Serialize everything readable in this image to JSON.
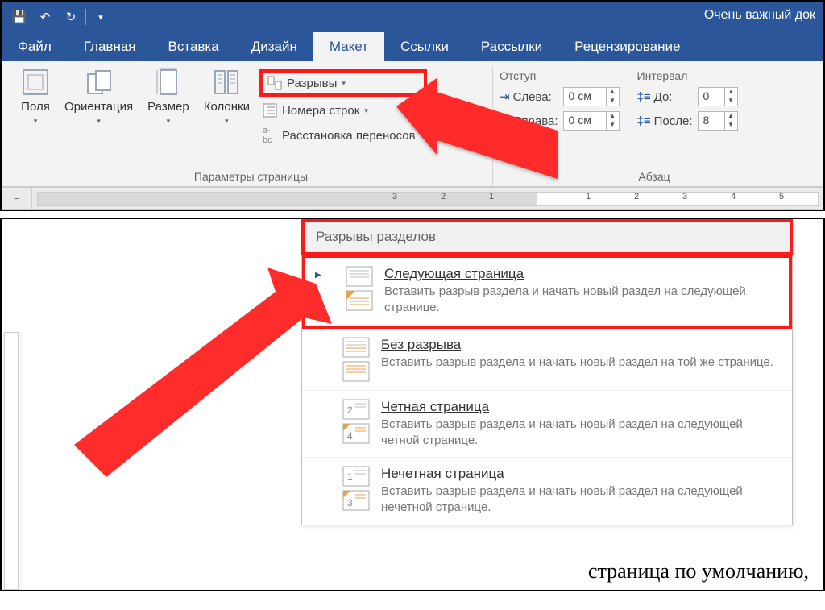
{
  "title": "Очень важный док",
  "tabs": [
    "Файл",
    "Главная",
    "Вставка",
    "Дизайн",
    "Макет",
    "Ссылки",
    "Рассылки",
    "Рецензирование"
  ],
  "active_tab_index": 4,
  "page_setup": {
    "margins": "Поля",
    "orientation": "Ориентация",
    "size": "Размер",
    "columns": "Колонки",
    "breaks": "Разрывы",
    "line_numbers": "Номера строк",
    "hyphenation": "Расстановка переносов",
    "group_label": "Параметры страницы"
  },
  "paragraph": {
    "indent_header": "Отступ",
    "spacing_header": "Интервал",
    "left_label": "Слева:",
    "right_label": "Справа:",
    "before_label": "До:",
    "after_label": "После:",
    "left_value": "0 см",
    "right_value": "0 см",
    "before_value": "0",
    "after_value": "8",
    "group_label": "Абзац"
  },
  "ruler_numbers": [
    "3",
    "2",
    "1",
    "1",
    "2",
    "3",
    "4",
    "5"
  ],
  "menu": {
    "header": "Разрывы разделов",
    "items": [
      {
        "title": "Следующая страница",
        "desc": "Вставить разрыв раздела и начать новый раздел на следующей странице."
      },
      {
        "title": "Без разрыва",
        "desc": "Вставить разрыв раздела и начать новый раздел на той же странице."
      },
      {
        "title": "Четная страница",
        "desc": "Вставить разрыв раздела и начать новый раздел на следующей четной странице."
      },
      {
        "title": "Нечетная страница",
        "desc": "Вставить разрыв раздела и начать новый раздел на следующей нечетной странице."
      }
    ]
  },
  "footer_text": "страница по умолчанию, "
}
